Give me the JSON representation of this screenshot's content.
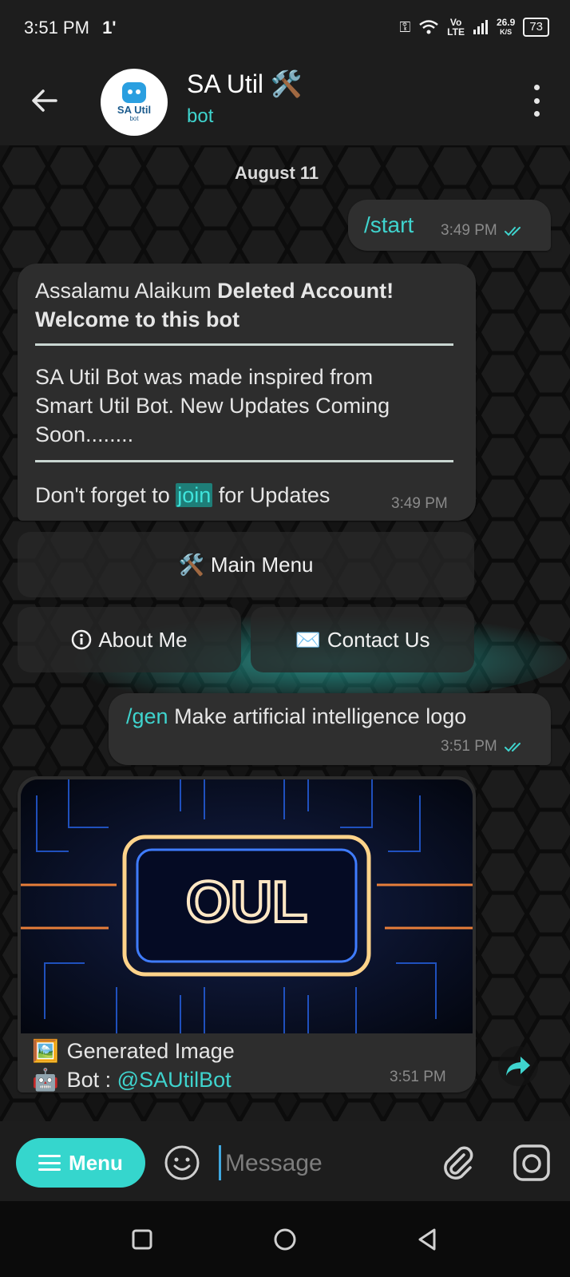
{
  "status_bar": {
    "time": "3:51 PM",
    "extra": "1'",
    "net_top": "Vo",
    "net_bottom": "LTE",
    "speed_value": "26.9",
    "speed_unit": "K/S",
    "battery": "73"
  },
  "header": {
    "title": "SA Util 🛠️",
    "subtitle": "bot",
    "avatar_line1": "SA Util",
    "avatar_line2": "bot"
  },
  "chat": {
    "date_chip": "August 11",
    "msg_start": {
      "text": "/start",
      "time": "3:49 PM"
    },
    "welcome": {
      "line1_plain": "Assalamu Alaikum ",
      "line1_bold": "Deleted Account!",
      "line2_bold": "Welcome to this bot",
      "body1": " SA Util Bot was made inspired from",
      "body2": "Smart Util Bot. New Updates Coming",
      "body3": "Soon........",
      "footer_pre": "Don't forget to ",
      "footer_link": "join",
      "footer_post": " for Updates",
      "time": "3:49 PM"
    },
    "keyboard": {
      "main_menu_icon": "🛠️",
      "main_menu": "Main Menu",
      "about_me": "About Me",
      "contact_icon": "✉️",
      "contact_us": "Contact Us"
    },
    "msg_gen": {
      "command": "/gen",
      "text": " Make artificial intelligence logo",
      "time": "3:51 PM"
    },
    "image_msg": {
      "image_text": "OUL",
      "caption1_icon": "🖼️",
      "caption1": "Generated Image",
      "caption2_icon": "🤖",
      "caption2_label": "Bot : ",
      "caption2_mention": "@SAUtilBot",
      "time": "3:51 PM"
    }
  },
  "input_bar": {
    "menu_label": "Menu",
    "placeholder": "Message"
  },
  "colors": {
    "accent": "#35d6cd",
    "link": "#3fd4ce",
    "bubble": "#2d2d2d",
    "header_bg": "#1d1d1d"
  }
}
